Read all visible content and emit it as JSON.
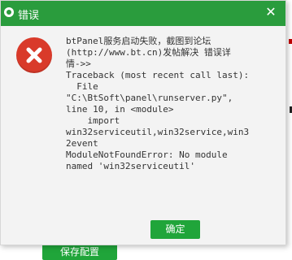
{
  "background": {
    "button_label": "保存配置"
  },
  "dialog": {
    "title": "错误",
    "close_glyph": "✕",
    "icon": "error-x-icon",
    "message": "btPanel服务启动失败，截图到论坛\n(http://www.bt.cn)发帖解决 错误详\n情->>\nTraceback (most recent call last):\n  File\n\"C:\\BtSoft\\panel\\runserver.py\",\nline 10, in <module>\n    import\nwin32serviceutil,win32service,win3\n2event\nModuleNotFoundError: No module\nnamed 'win32serviceutil'",
    "ok_label": "确定"
  },
  "colors": {
    "title_bar": "#2a9c3d",
    "button": "#20a53a",
    "error_icon": "#d93a2a",
    "dialog_bg": "#f3f3f3"
  }
}
